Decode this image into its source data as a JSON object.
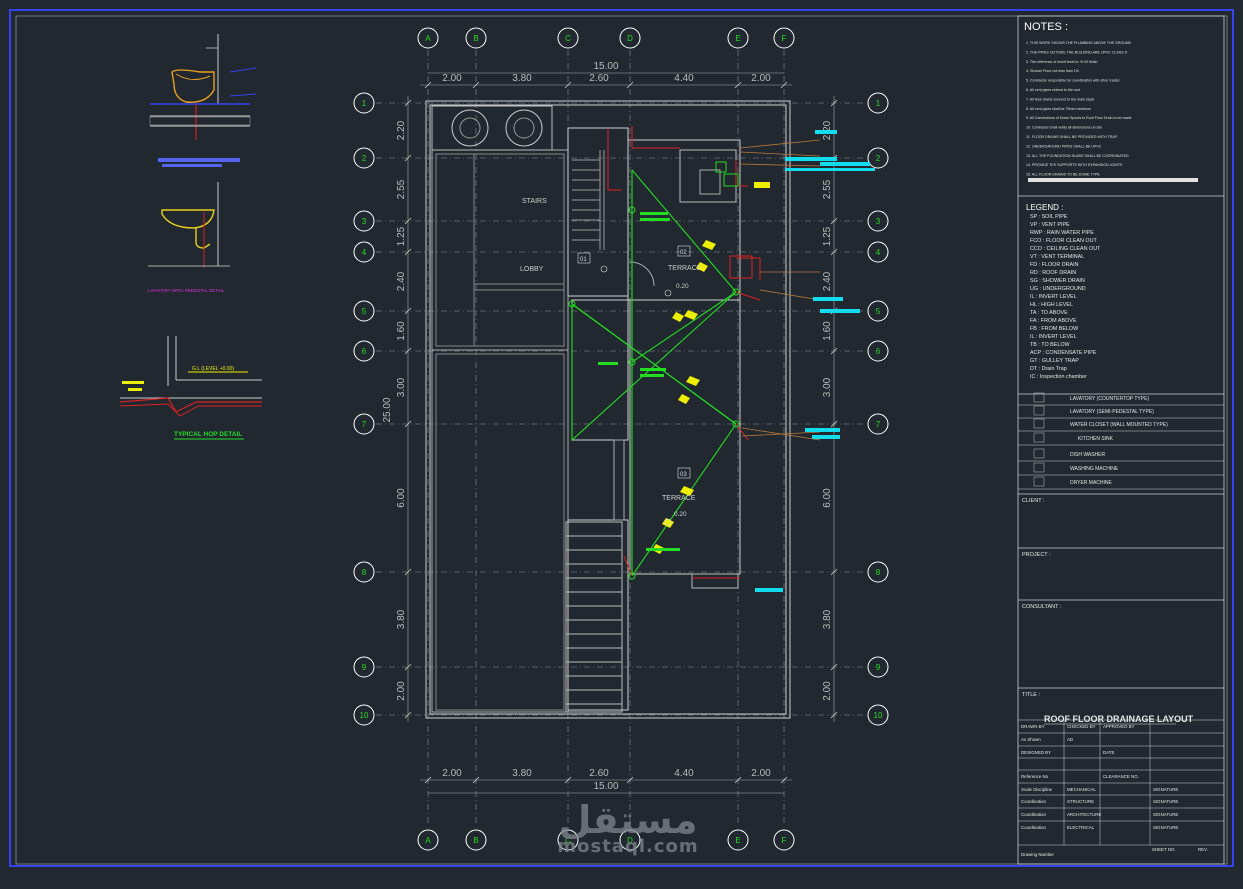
{
  "grid": {
    "cols": [
      "A",
      "B",
      "C",
      "D",
      "E",
      "F"
    ],
    "rows": [
      "1",
      "2",
      "3",
      "4",
      "5",
      "6",
      "7",
      "8",
      "9",
      "10"
    ]
  },
  "dims": {
    "top_total": "15.00",
    "bottom_total": "15.00",
    "top": [
      "2.00",
      "3.80",
      "2.60",
      "4.40",
      "2.00"
    ],
    "bottom": [
      "2.00",
      "3.80",
      "2.60",
      "4.40",
      "2.00"
    ],
    "left": [
      "2.20",
      "2.55",
      "1.25",
      "2.40",
      "1.60",
      "3.00",
      "6.00",
      "3.80",
      "2.00"
    ],
    "left_total": "25.00",
    "right": [
      "2.20",
      "2.55",
      "1.25",
      "2.40",
      "1.60",
      "3.00",
      "6.00",
      "3.80",
      "2.00"
    ]
  },
  "plan": {
    "stairs": "STAIRS",
    "lobby": "LOBBY",
    "terrace_1": "TERRACE",
    "terrace_2": "TERRACE",
    "level_1": "0.20",
    "level_2": "0.20",
    "tag_01": "01",
    "tag_02": "02",
    "tag_03": "03"
  },
  "details": {
    "lavatory_caption": "LAVATORY WITH PEDESTAL DETAIL",
    "hop_caption": "TYPICAL HOP DETAIL",
    "hop_label": "G.L (LEVEL +0.00)"
  },
  "notes": {
    "title": "NOTES :",
    "items": [
      "1. THIS WORK SHOWS THE PLUMBING ABOVE THE GROUND",
      "2. THE PIPES OUTSIDE THE BUILDING ARE UPVC CLASS D",
      "3. The reference of invert level is +0.00 finish",
      "4. Shower Floor not less than 1%",
      "5. Contractor responsible for coordination with other trades",
      "6. All vent pipes extend to the roof",
      "7. All floor drains connect to the main stack",
      "8. All vent pipes shall be 75mm minimum",
      "9. All Connections of Down Spouts to Roof Floor Drain to be made",
      "10. Contractor shall verify all dimensions on site",
      "11. FLOOR DRAINS SHALL BE PROVIDED WITH TRAP",
      "12. UNDERGROUND PIPES SHALL BE UPVC",
      "13. ALL THE FOUNDATION SLABS SHALL BE COORDINATED",
      "14. PROVIDE TEE SUPPORTS WITH EXPANSION JOINTS",
      "15. ALL FLOOR DRAINS TO BE DOME TYPE"
    ]
  },
  "legend": {
    "title": "LEGEND :",
    "items": [
      "SP : SOIL PIPE",
      "VP : VENT PIPE",
      "RWP : RAIN WATER PIPE",
      "FCO : FLOOR CLEAN OUT",
      "CCO : CEILING CLEAN OUT",
      "VT : VENT TERMINAL",
      "FD : FLOOR DRAIN",
      "RD : ROOF DRAIN",
      "SG : SHOWER DRAIN",
      "UG : UNDERGROUND",
      "IL : INVERT LEVEL",
      "HL : HIGH LEVEL",
      "TA : TO ABOVE",
      "FA : FROM ABOVE",
      "FB : FROM BELOW",
      "IL : INVERT LEVEL",
      "TB : TO BELOW",
      "ACP : CONDENSATE PIPE",
      "GT : GULLEY TRAP",
      "DT : Drain Trap",
      "IC : Inspection chamber"
    ]
  },
  "fixtures": [
    "LAVATORY (COUNTERTOP TYPE)",
    "LAVATORY (SEMI-PEDESTAL TYPE)",
    "WATER CLOSET (WALL MOUNTED TYPE)",
    "KITCHEN SINK",
    "DISH WASHER",
    "WASHING MACHINE",
    "DRYER MACHINE"
  ],
  "titleblock": {
    "client": "CLIENT :",
    "project": "PROJECT :",
    "consultant": "CONSULTANT :",
    "title_label": "TITLE :",
    "title": "ROOF FLOOR DRAINAGE LAYOUT",
    "rows": [
      [
        "DRAWN BY",
        "CHECKED BY",
        "APPROVED BY",
        ""
      ],
      [
        "As Shown",
        "AD",
        "",
        ""
      ],
      [
        "DESIGNED BY",
        "",
        "DATE",
        ""
      ],
      [
        "",
        "",
        "",
        ""
      ],
      [
        "Reference No",
        "",
        "CLEARANCE NO.",
        ""
      ],
      [
        "Scale Discipline",
        "MECHANICAL",
        "",
        "SIGNATURE"
      ],
      [
        "Coordination",
        "STRUCTURE",
        "",
        "SIGNATURE"
      ],
      [
        "Coordination",
        "ARCHITECTURE",
        "",
        "SIGNATURE"
      ],
      [
        "Coordination",
        "ELECTRICAL",
        "",
        "SIGNATURE"
      ]
    ],
    "drawing_number": "Drawing Number",
    "sheet": "SHEET NO.",
    "rev": "REV."
  },
  "watermark": {
    "arabic": "مستقل",
    "latin": "mostaql.com"
  },
  "colors": {
    "background": "#212830",
    "green": "#22dd22",
    "cyan": "#11ddee",
    "yellow": "#eeee00",
    "red": "#dd2222",
    "grid_circle": "#ffffff"
  }
}
